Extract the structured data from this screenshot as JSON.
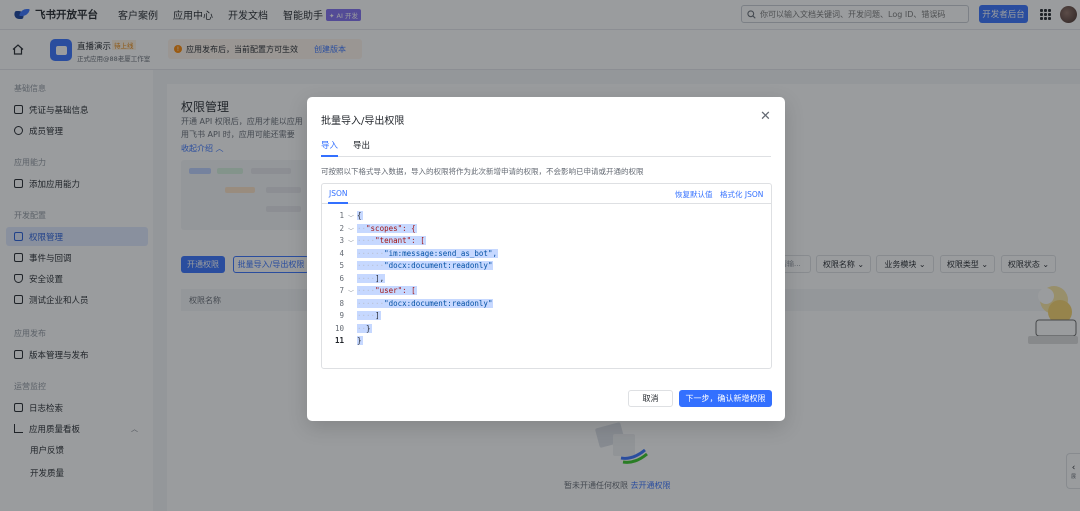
{
  "topbar": {
    "logo": "飞书开放平台",
    "nav": [
      "客户案例",
      "应用中心",
      "开发文档",
      "智能助手"
    ],
    "ai_badge": "✦ AI 开发",
    "search_placeholder": "你可以输入文档关键词、开发问题、Log ID、错误码",
    "dev_console": "开发者后台"
  },
  "appbar": {
    "app_name": "直播演示",
    "app_status": "待上线",
    "app_subtitle": "正式应用@88老厦工作室",
    "notice": "应用发布后，当前配置方可生效",
    "notice_link": "创建版本"
  },
  "sidebar": {
    "sections": [
      {
        "title": "基础信息",
        "items": [
          "凭证与基础信息",
          "成员管理"
        ]
      },
      {
        "title": "应用能力",
        "items": [
          "添加应用能力"
        ]
      },
      {
        "title": "开发配置",
        "items": [
          "权限管理",
          "事件与回调",
          "安全设置",
          "测试企业和人员"
        ]
      },
      {
        "title": "应用发布",
        "items": [
          "版本管理与发布"
        ]
      },
      {
        "title": "运营监控",
        "items": [
          "日志检索",
          "应用质量看板",
          "用户反馈",
          "开发质量"
        ]
      }
    ]
  },
  "main": {
    "title": "权限管理",
    "desc_line1": "开通 API 权限后，应用才能以应用",
    "desc_line2": "用飞书 API 时，应用可能还需要",
    "collapse": "收起介绍",
    "btn_open": "开通权限",
    "btn_batch": "批量导入/导出权限",
    "filter_placeholder": "请输...",
    "filters": [
      "权限名称",
      "业务模块",
      "权限类型",
      "权限状态"
    ],
    "table_header": "权限名称",
    "empty_text": "暂未开通任何权限",
    "empty_link": "去开通权限"
  },
  "modal": {
    "title": "批量导入/导出权限",
    "tabs": [
      "导入",
      "导出"
    ],
    "description": "可按照以下格式导入数据，导入的权限将作为此次新增申请的权限，不会影响已申请或开通的权限",
    "editor_tab": "JSON",
    "action_reset": "恢复默认值",
    "action_format": "格式化 JSON",
    "code_lines": [
      "{",
      "\"scopes\": {",
      "\"tenant\": [",
      "\"im:message:send_as_bot\",",
      "\"docx:document:readonly\"",
      "],",
      "\"user\": [",
      "\"docx:document:readonly\"",
      "]",
      "}",
      "}"
    ],
    "cancel": "取消",
    "next": "下一步，确认新增权限"
  },
  "side_tab": "展"
}
